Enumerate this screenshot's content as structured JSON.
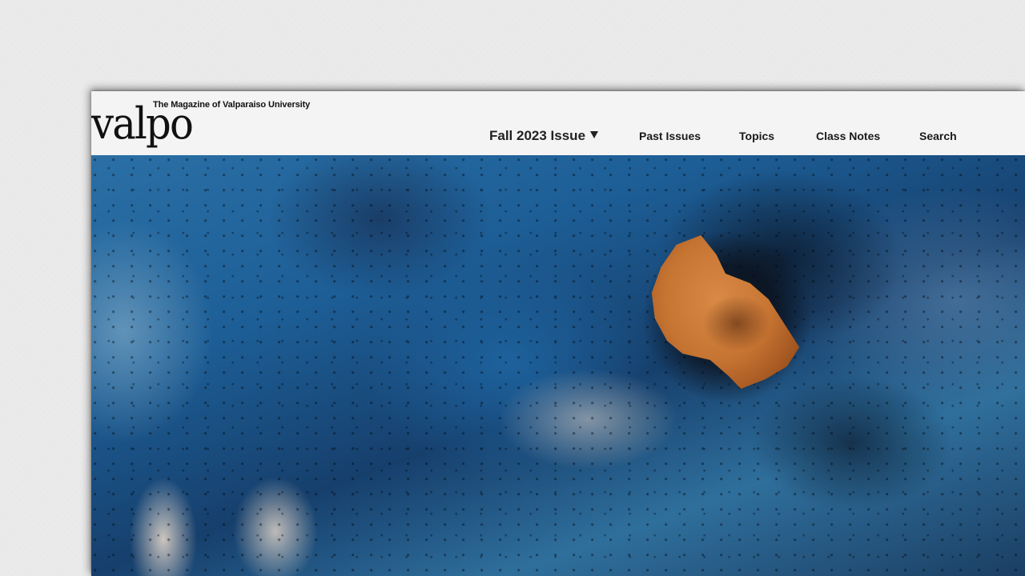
{
  "header": {
    "logo": "valpo",
    "tagline": "The Magazine of Valparaiso University"
  },
  "nav": {
    "items": [
      {
        "label": "Fall 2023 Issue",
        "current": true,
        "has_dropdown": true
      },
      {
        "label": "Past Issues"
      },
      {
        "label": "Topics"
      },
      {
        "label": "Class Notes"
      },
      {
        "label": "Search"
      }
    ]
  },
  "hero": {
    "image": "abstract blue watercolor texture with burnt hole revealing orange"
  },
  "icons": {
    "dropdown": "caret-down-icon"
  },
  "colors": {
    "header_bg": "#f4f4f4",
    "text": "#111111",
    "page_bg": "#ededed"
  }
}
